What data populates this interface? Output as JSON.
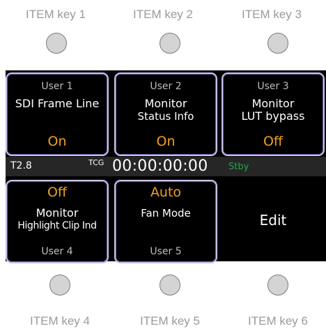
{
  "keys": [
    {
      "label": "ITEM key 1"
    },
    {
      "label": "ITEM key 2"
    },
    {
      "label": "ITEM key 3"
    },
    {
      "label": "ITEM key 4"
    },
    {
      "label": "ITEM key 5"
    },
    {
      "label": "ITEM key 6"
    }
  ],
  "tiles": [
    {
      "user": "User 1",
      "name": "SDI Frame Line",
      "value": "On"
    },
    {
      "user": "User 2",
      "name_line1": "Monitor",
      "name_line2": "Status Info",
      "value": "On"
    },
    {
      "user": "User 3",
      "name_line1": "Monitor",
      "name_line2": "LUT bypass",
      "value": "Off"
    },
    {
      "user": "User 4",
      "name_line1": "Monitor",
      "name_line2": "Highlight Clip Ind",
      "value": "Off"
    },
    {
      "user": "User 5",
      "name": "Fan Mode",
      "value": "Auto"
    }
  ],
  "status_bar": {
    "iris": "T2.8",
    "tc_label": "TCG",
    "timecode": "00:00:00:00",
    "rec_state": "Stby"
  },
  "edit_label": "Edit",
  "colors": {
    "value_orange": "#f0a020",
    "stby_green": "#1fa64a",
    "tile_border": "#c8bfe6"
  }
}
